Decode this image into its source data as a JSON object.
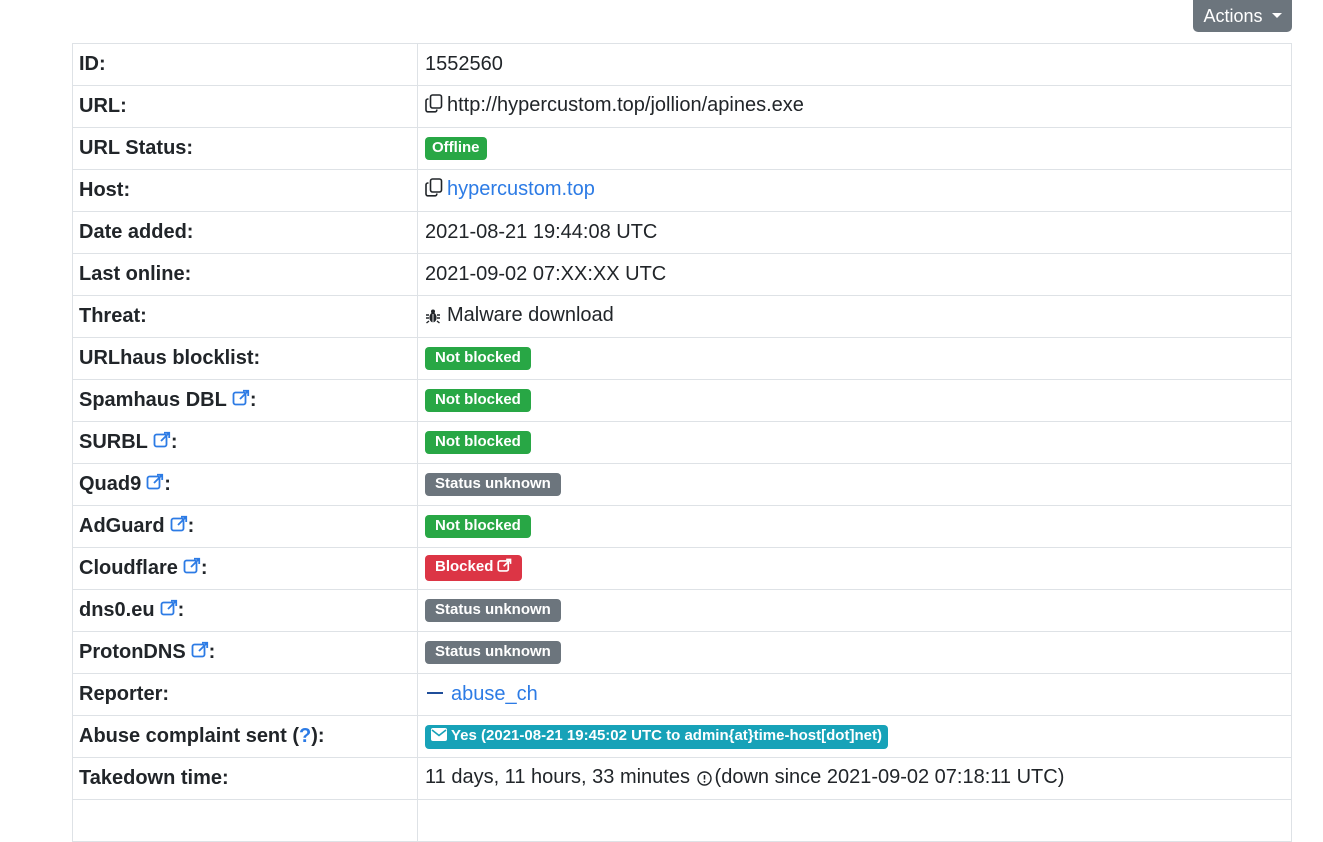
{
  "actions_label": "Actions",
  "rows": {
    "id": {
      "label": "ID:",
      "value": "1552560"
    },
    "url": {
      "label": "URL:",
      "value": "http://hypercustom.top/jollion/apines.exe"
    },
    "url_status": {
      "label": "URL Status:",
      "badge": "Offline"
    },
    "host": {
      "label": "Host:",
      "value": "hypercustom.top"
    },
    "date_added": {
      "label": "Date added:",
      "value": "2021-08-21 19:44:08 UTC"
    },
    "last_online": {
      "label": "Last online:",
      "value": "2021-09-02 07:XX:XX UTC"
    },
    "threat": {
      "label": "Threat:",
      "value": "Malware download"
    },
    "urlhaus": {
      "label": "URLhaus blocklist:",
      "badge": "Not blocked"
    },
    "spamhaus": {
      "label": "Spamhaus DBL",
      "badge": "Not blocked"
    },
    "surbl": {
      "label": "SURBL",
      "badge": "Not blocked"
    },
    "quad9": {
      "label": "Quad9",
      "badge": "Status unknown"
    },
    "adguard": {
      "label": "AdGuard",
      "badge": "Not blocked"
    },
    "cloudflare": {
      "label": "Cloudflare",
      "badge": "Blocked"
    },
    "dns0": {
      "label": "dns0.eu",
      "badge": "Status unknown"
    },
    "protondns": {
      "label": "ProtonDNS",
      "badge": "Status unknown"
    },
    "reporter": {
      "label": "Reporter:",
      "value": "abuse_ch"
    },
    "abuse": {
      "label_prefix": "Abuse complaint sent (",
      "help": "?",
      "label_suffix": "):",
      "badge": "Yes (2021-08-21 19:45:02 UTC to admin{at}time-host[dot]net)"
    },
    "takedown": {
      "label": "Takedown time:",
      "value": "11 days, 11 hours, 33 minutes",
      "suffix": "(down since 2021-09-02 07:18:11 UTC)"
    }
  },
  "colors": {
    "green": "#28a745",
    "grey": "#6c757d",
    "red": "#dc3545",
    "teal": "#17a2b8",
    "link": "#2c7be5"
  }
}
